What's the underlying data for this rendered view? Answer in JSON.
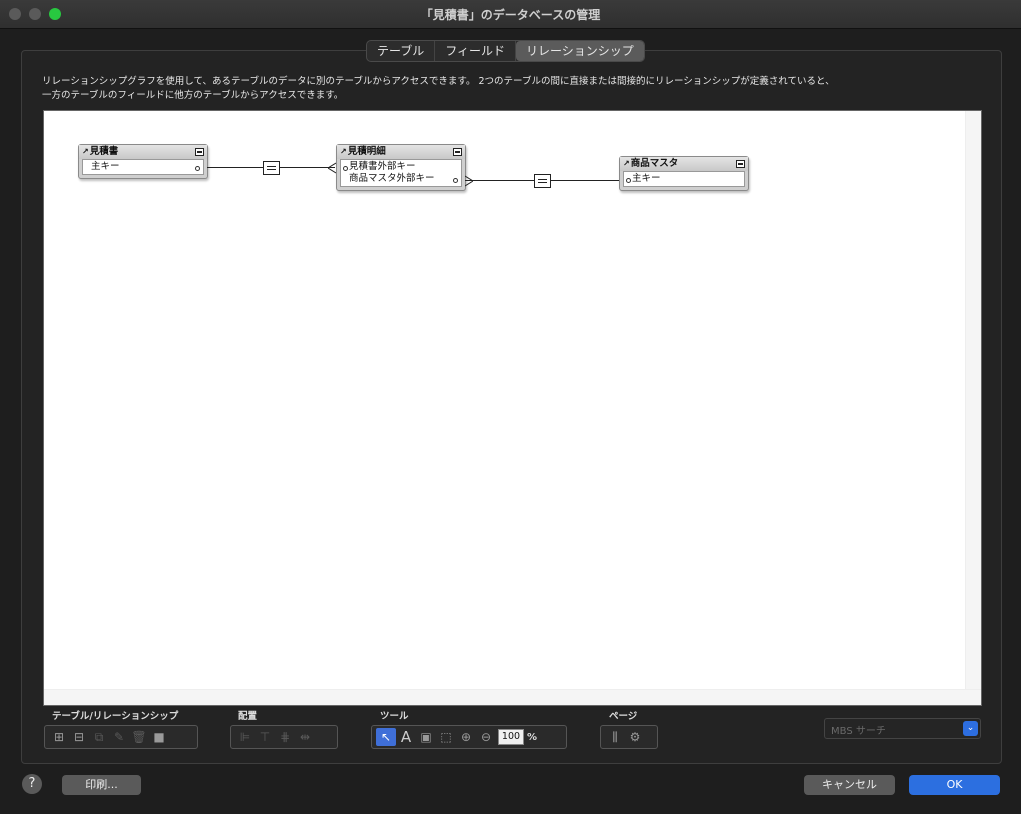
{
  "window": {
    "title": "「見積書」のデータベースの管理"
  },
  "tabs": [
    {
      "label": "テーブル"
    },
    {
      "label": "フィールド"
    },
    {
      "label": "リレーションシップ",
      "active": true
    }
  ],
  "description": {
    "line1": "リレーションシップグラフを使用して、あるテーブルのデータに別のテーブルからアクセスできます。 2つのテーブルの間に直接または間接的にリレーションシップが定義されていると、",
    "line2": "一方のテーブルのフィールドに他方のテーブルからアクセスできます。"
  },
  "graph": {
    "tables": [
      {
        "name": "見積書",
        "fields": [
          "主キー"
        ]
      },
      {
        "name": "見積明細",
        "fields": [
          "見積書外部キー",
          "商品マスタ外部キー"
        ]
      },
      {
        "name": "商品マスタ",
        "fields": [
          "主キー"
        ]
      }
    ],
    "relations": [
      {
        "from": "見積書",
        "to": "見積明細",
        "operator": "="
      },
      {
        "from": "見積明細",
        "to": "商品マスタ",
        "operator": "="
      }
    ]
  },
  "toolbar": {
    "group_table_label": "テーブル/リレーションシップ",
    "group_arrange_label": "配置",
    "group_tools_label": "ツール",
    "group_page_label": "ページ",
    "zoom_value": "100",
    "zoom_unit": "%",
    "search_placeholder": "MBS サーチ"
  },
  "footer": {
    "help_label": "?",
    "print_label": "印刷...",
    "cancel_label": "キャンセル",
    "ok_label": "OK"
  },
  "colors": {
    "accent": "#2c6fe0",
    "zoom_green": "#28c840"
  }
}
